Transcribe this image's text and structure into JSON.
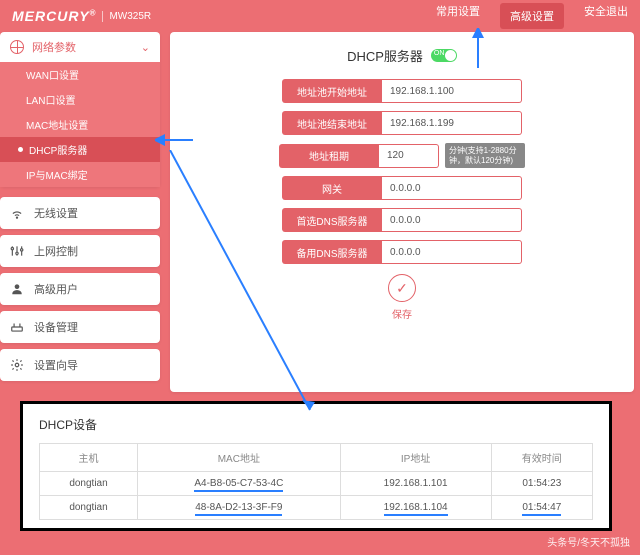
{
  "header": {
    "brand": "MERCURY",
    "model": "MW325R",
    "nav": {
      "common": "常用设置",
      "advanced": "高级设置",
      "logout": "安全退出"
    }
  },
  "sidebar": {
    "network": {
      "title": "网络参数",
      "items": [
        "WAN口设置",
        "LAN口设置",
        "MAC地址设置",
        "DHCP服务器",
        "IP与MAC绑定"
      ]
    },
    "menus": {
      "wireless": "无线设置",
      "control": "上网控制",
      "adv_users": "高级用户",
      "device_mgmt": "设备管理",
      "wizard": "设置向导"
    }
  },
  "main": {
    "title": "DHCP服务器",
    "toggle_label": "ON",
    "fields": {
      "start_ip": {
        "label": "地址池开始地址",
        "value": "192.168.1.100"
      },
      "end_ip": {
        "label": "地址池结束地址",
        "value": "192.168.1.199"
      },
      "lease": {
        "label": "地址租期",
        "value": "120",
        "hint": "分钟(支持1-2880分钟，默认120分钟)"
      },
      "gateway": {
        "label": "网关",
        "value": "0.0.0.0"
      },
      "dns1": {
        "label": "首选DNS服务器",
        "value": "0.0.0.0"
      },
      "dns2": {
        "label": "备用DNS服务器",
        "value": "0.0.0.0"
      }
    },
    "save": "保存"
  },
  "devices": {
    "title": "DHCP设备",
    "columns": [
      "主机",
      "MAC地址",
      "IP地址",
      "有效时间"
    ],
    "rows": [
      {
        "host": "dongtian",
        "mac": "A4-B8-05-C7-53-4C",
        "ip": "192.168.1.101",
        "time": "01:54:23"
      },
      {
        "host": "dongtian",
        "mac": "48-8A-D2-13-3F-F9",
        "ip": "192.168.1.104",
        "time": "01:54:47"
      }
    ]
  },
  "watermark": "头条号/冬天不孤独"
}
